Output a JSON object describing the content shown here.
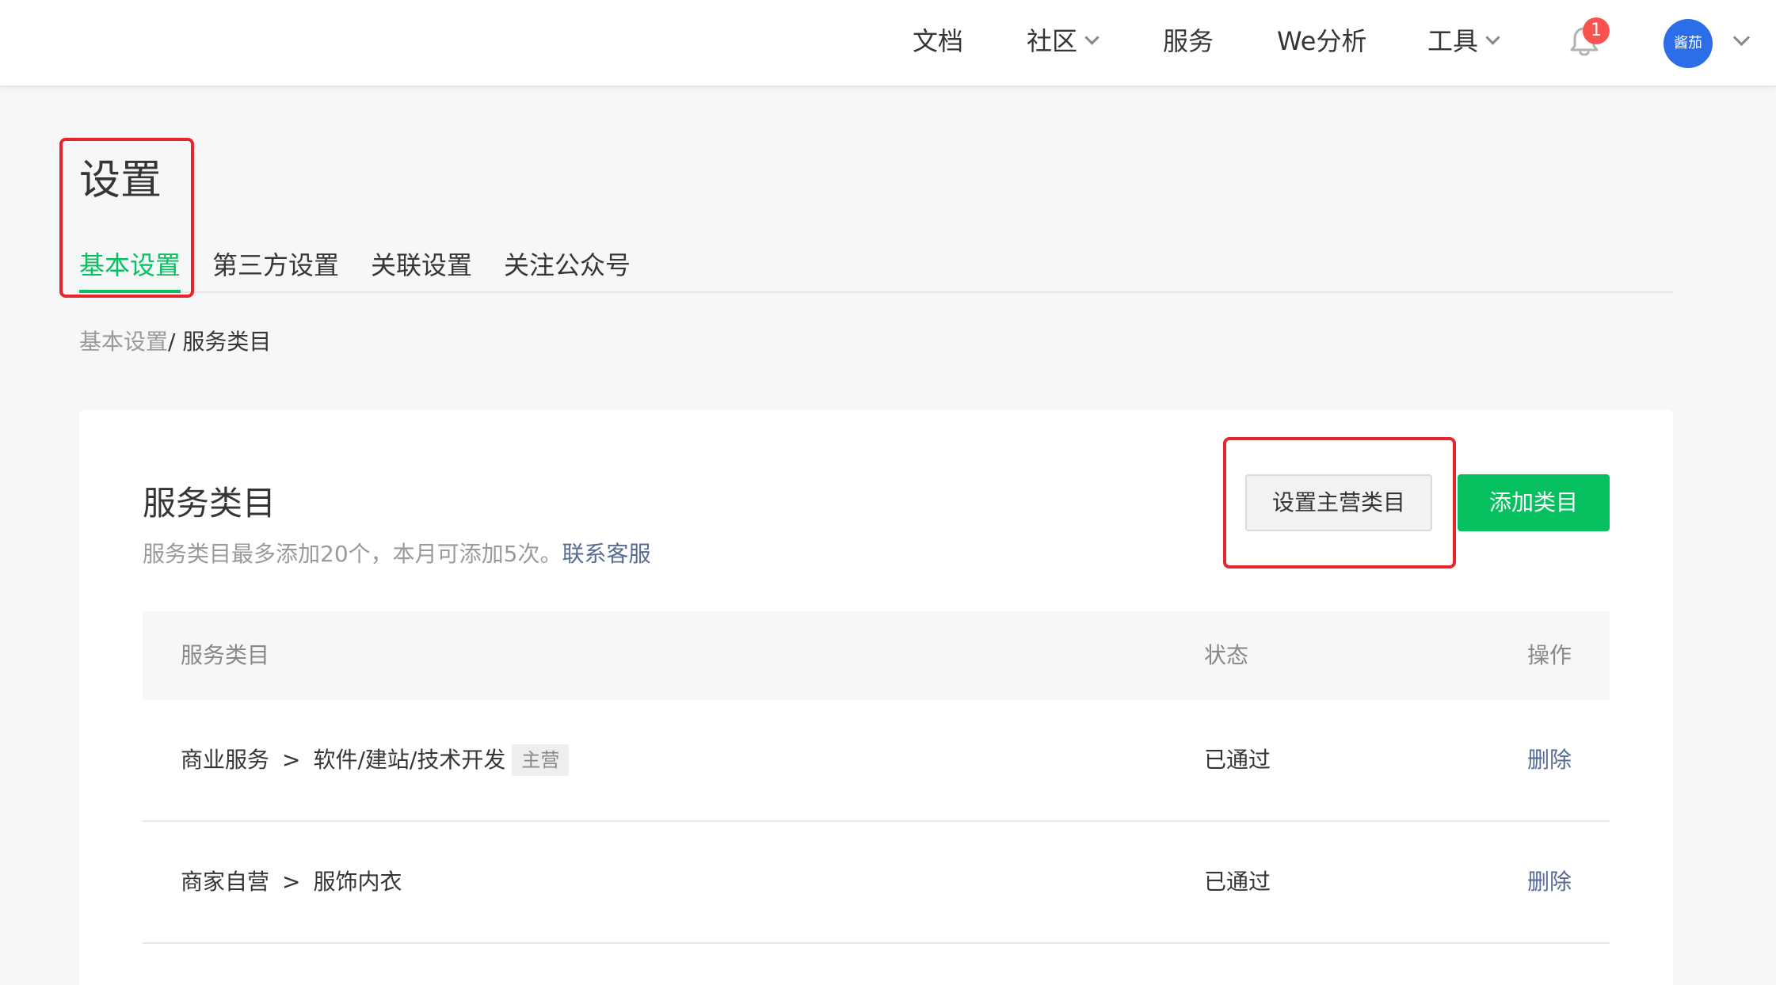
{
  "topnav": {
    "items": [
      {
        "label": "文档",
        "has_dropdown": false
      },
      {
        "label": "社区",
        "has_dropdown": true
      },
      {
        "label": "服务",
        "has_dropdown": false
      },
      {
        "label": "We分析",
        "has_dropdown": false
      },
      {
        "label": "工具",
        "has_dropdown": true
      }
    ],
    "notification_count": "1",
    "avatar_text": "酱茄"
  },
  "page": {
    "title": "设置",
    "tabs": [
      {
        "label": "基本设置",
        "active": true
      },
      {
        "label": "第三方设置",
        "active": false
      },
      {
        "label": "关联设置",
        "active": false
      },
      {
        "label": "关注公众号",
        "active": false
      }
    ],
    "breadcrumb": {
      "parent": "基本设置",
      "separator": "/ ",
      "current": "服务类目"
    }
  },
  "card": {
    "title": "服务类目",
    "description": "服务类目最多添加20个，本月可添加5次。",
    "contact_link": "联系客服",
    "set_main_button": "设置主营类目",
    "add_button": "添加类目",
    "table": {
      "headers": {
        "category": "服务类目",
        "status": "状态",
        "action": "操作"
      },
      "rows": [
        {
          "level1": "商业服务",
          "arrow": ">",
          "level2": "软件/建站/技术开发",
          "tag": "主营",
          "status": "已通过",
          "action": "删除"
        },
        {
          "level1": "商家自营",
          "arrow": ">",
          "level2": "服饰内衣",
          "tag": "",
          "status": "已通过",
          "action": "删除"
        }
      ]
    }
  },
  "colors": {
    "accent_green": "#07c160",
    "link_blue": "#576b95",
    "highlight_red": "#e8252a",
    "badge_red": "#fa5151",
    "avatar_blue": "#2c6ee8"
  }
}
